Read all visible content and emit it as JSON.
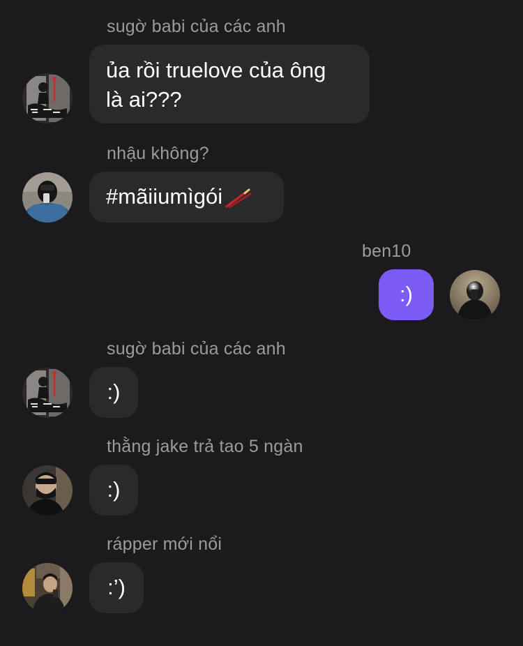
{
  "messages": [
    {
      "sender": "sugờ babi của các anh",
      "text_lines": [
        "ủa rồi truelove của ông",
        "là ai???"
      ],
      "avatar": "graffiti-sticker-avatar"
    },
    {
      "sender": "nhậu không?",
      "text": "#mãiiumìgói",
      "emoji_icon": "chopsticks-icon",
      "avatar": "hooded-person-avatar"
    },
    {
      "sender": "ben10",
      "text": ":)",
      "avatar": "flash-selfie-avatar",
      "outgoing": true
    },
    {
      "sender": "sugờ babi của các anh",
      "text": ":)",
      "avatar": "graffiti-sticker-avatar"
    },
    {
      "sender": "thằng jake trả tao 5 ngàn",
      "text": ":)",
      "avatar": "masked-person-avatar"
    },
    {
      "sender": "rápper mới nổi",
      "text": ":’)",
      "avatar": "person-in-room-avatar"
    }
  ],
  "colors": {
    "background": "#1b1b1d",
    "incoming_bubble": "#2a2a2d",
    "outgoing_bubble": "#7c5cf5",
    "sender_text": "#9b9ba0"
  }
}
